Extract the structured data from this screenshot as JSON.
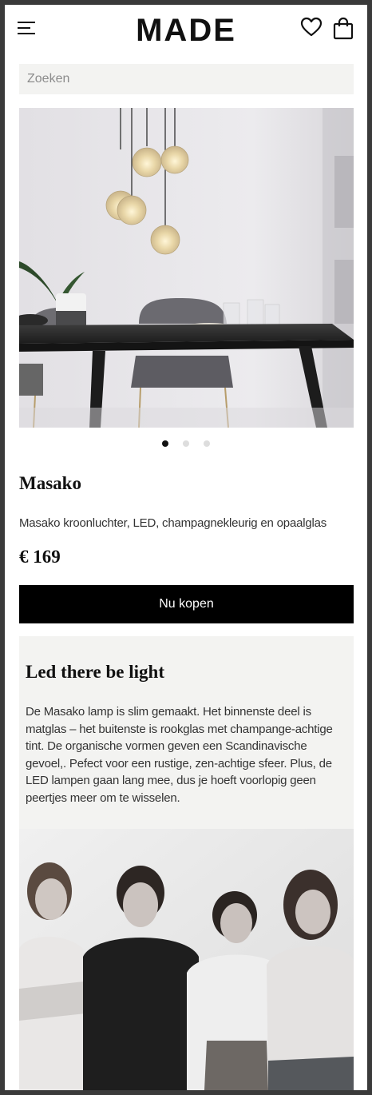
{
  "header": {
    "logo": "MADE",
    "menu_icon": "hamburger-menu-icon",
    "wishlist_icon": "heart-icon",
    "cart_icon": "shopping-bag-icon"
  },
  "search": {
    "placeholder": "Zoeken",
    "value": ""
  },
  "carousel": {
    "slide_count": 3,
    "active_index": 0
  },
  "product": {
    "name": "Masako",
    "description": "Masako kroonluchter, LED, champagnekleurig en opaalglas",
    "price": "€ 169",
    "buy_label": "Nu kopen"
  },
  "story": {
    "title": "Led there be light",
    "text": "De Masako lamp is slim gemaakt. Het binnenste deel is matglas – het buitenste is rookglas met champange-achtige tint. De organische vormen geven een Scandinavische gevoel,. Pefect voor een rustige, zen-achtige sfeer. Plus, de LED lampen gaan lang mee, dus je hoeft voorlopig geen peertjes meer om te wisselen."
  },
  "colors": {
    "background_frame": "#3a3a3a",
    "panel": "#f3f3f1",
    "button": "#000000",
    "text": "#111111"
  }
}
